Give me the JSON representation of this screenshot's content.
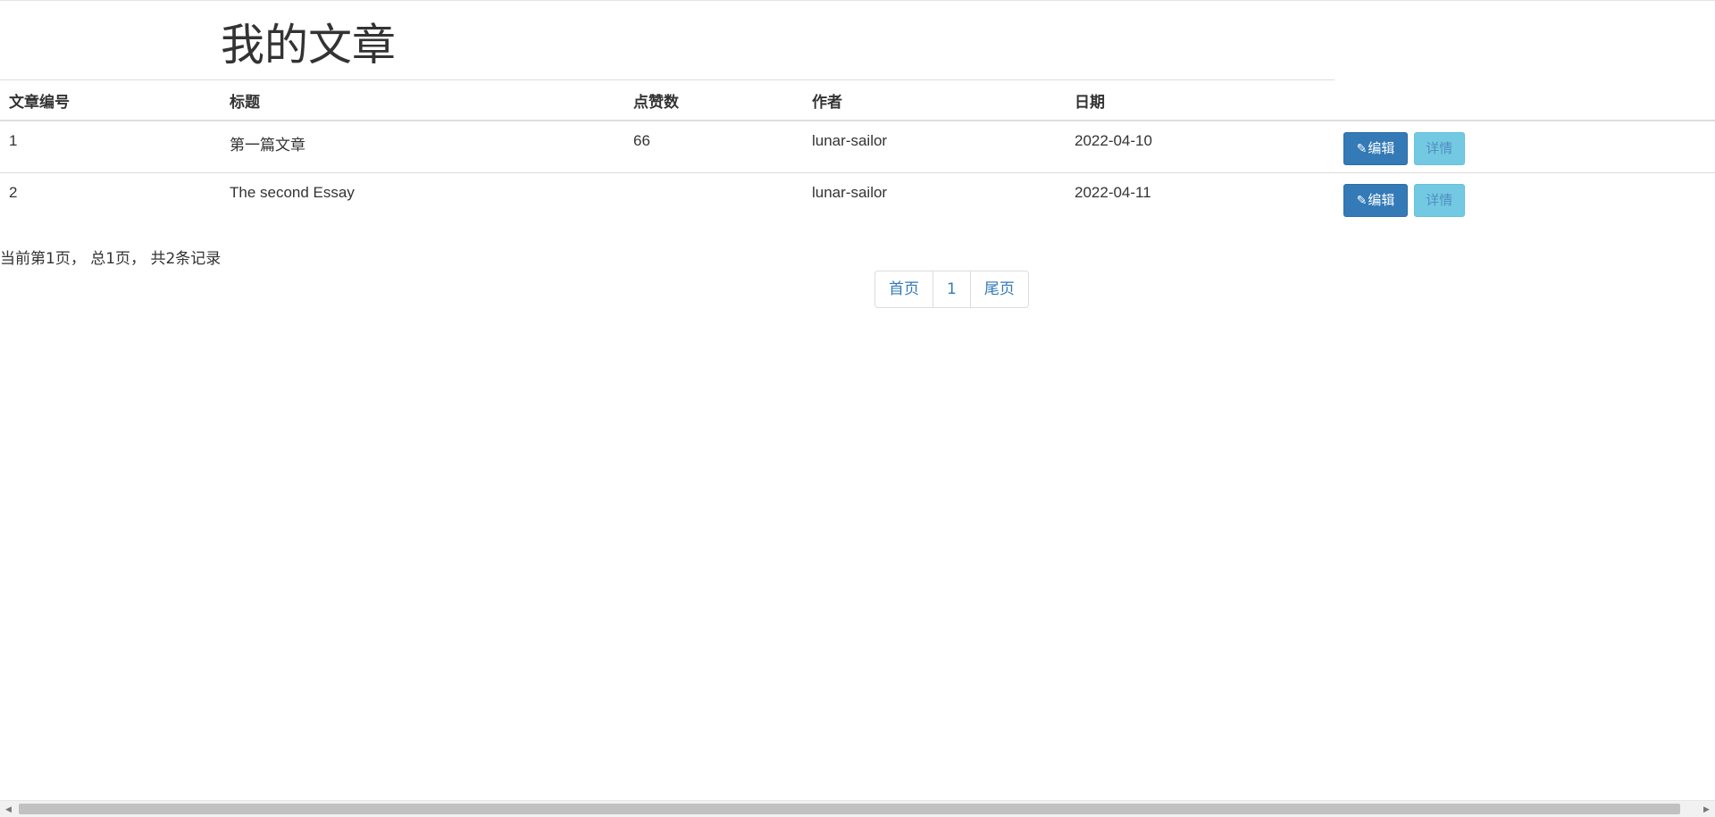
{
  "page": {
    "title": "我的文章"
  },
  "table": {
    "headers": [
      "文章编号",
      "标题",
      "点赞数",
      "作者",
      "日期"
    ],
    "rows": [
      {
        "id": "1",
        "title": "第一篇文章",
        "likes": "66",
        "author": "lunar-sailor",
        "date": "2022-04-10"
      },
      {
        "id": "2",
        "title": "The second Essay",
        "likes": "",
        "author": "lunar-sailor",
        "date": "2022-04-11"
      }
    ],
    "edit_label": "编辑",
    "detail_label": "详情",
    "edit_icon": "pencil-icon"
  },
  "pagination": {
    "summary": "当前第1页， 总1页， 共2条记录",
    "first_label": "首页",
    "current_page": "1",
    "last_label": "尾页"
  },
  "colors": {
    "primary": "#337ab7",
    "info": "#5bc0de",
    "link": "#337ab7"
  }
}
